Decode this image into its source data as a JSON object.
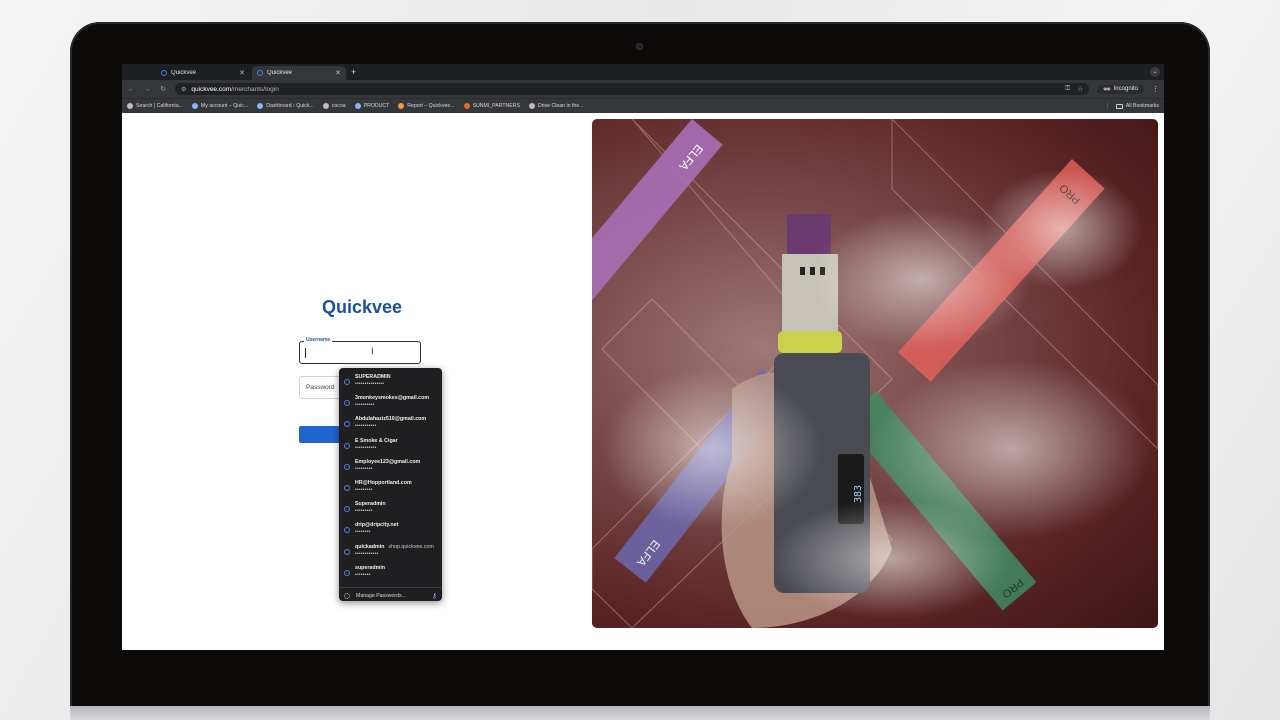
{
  "browser": {
    "tabs": [
      {
        "title": "Quickvee",
        "active": false
      },
      {
        "title": "Quickvee",
        "active": true
      }
    ],
    "new_tab_label": "+",
    "url_host": "quickvee.com",
    "url_path": "/merchants/login",
    "incognito_label": "Incognito",
    "bookmarks": [
      {
        "label": "Search | California...",
        "icon": "globe-icon"
      },
      {
        "label": "My account – Quic...",
        "icon": "quickvee-icon"
      },
      {
        "label": "Dashboard ‹ Quick...",
        "icon": "quickvee-icon"
      },
      {
        "label": "cocoa",
        "icon": "globe-icon"
      },
      {
        "label": "PRODUCT",
        "icon": "quickvee-icon"
      },
      {
        "label": "Report – Quickvee...",
        "icon": "report-icon"
      },
      {
        "label": "SUNMI_PARTNERS",
        "icon": "sunmi-icon"
      },
      {
        "label": "Drive Clean in the...",
        "icon": "globe-icon"
      }
    ],
    "all_bookmarks_label": "All Bookmarks"
  },
  "login": {
    "logo_text": "Quickvee",
    "username_label": "Username",
    "password_placeholder": "Password"
  },
  "autofill": {
    "items": [
      {
        "username": "SUPERADMIN",
        "password_mask": "•••••••••••••••"
      },
      {
        "username": "3monkeysmokes@gmail.com",
        "password_mask": "••••••••••"
      },
      {
        "username": "Abdulahaziz510@gmail.com",
        "password_mask": "•••••••••••"
      },
      {
        "username": "E Smoke & Cigar",
        "password_mask": "•••••••••••"
      },
      {
        "username": "Employee123@gmail.com",
        "password_mask": "•••••••••"
      },
      {
        "username": "HR@Hopportland.com",
        "password_mask": "•••••••••"
      },
      {
        "username": "Superadmin",
        "password_mask": "•••••••••"
      },
      {
        "username": "drip@dripcity.net",
        "password_mask": "••••••••"
      },
      {
        "username": "quickadmin",
        "site": "shop.quickvee.com",
        "password_mask": "••••••••••••"
      },
      {
        "username": "superadmin",
        "password_mask": "••••••••"
      }
    ],
    "manage_label": "Manage Passwords..."
  },
  "photo": {
    "product_label_1": "ELFA",
    "product_label_2": "PRO",
    "device_display": "383"
  },
  "colors": {
    "brand_blue": "#1c4fa0",
    "button_blue": "#1f64d1",
    "dropdown_bg": "#1f1f21"
  }
}
